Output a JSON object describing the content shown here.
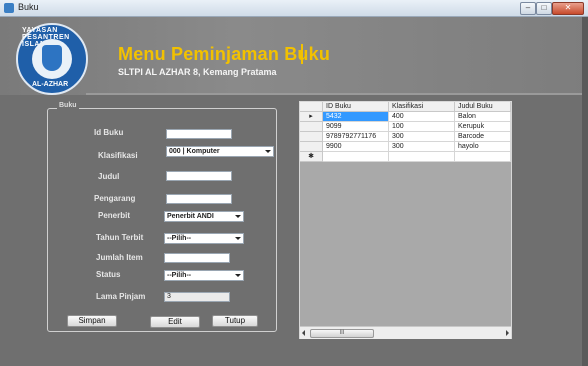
{
  "window": {
    "title": "Buku",
    "min_label": "–",
    "max_label": "□",
    "close_label": "✕"
  },
  "header": {
    "title": "Menu  Peminjaman Buku",
    "subtitle": "SLTPI AL AZHAR 8,  Kemang Pratama",
    "logo_ring_top": "YAYASAN PESANTREN ISLAM",
    "logo_ring_bottom": "AL-AZHAR"
  },
  "form": {
    "group_label": "Buku",
    "id_buku_label": "Id Buku",
    "id_buku_value": "",
    "klasifikasi_label": "Klasifikasi",
    "klasifikasi_value": "000   | Komputer",
    "judul_label": "Judul",
    "judul_value": "",
    "pengarang_label": "Pengarang",
    "pengarang_value": "",
    "penerbit_label": "Penerbit",
    "penerbit_value": "Penerbit ANDI",
    "tahun_label": "Tahun Terbit",
    "tahun_value": "--Pilih--",
    "jumlah_label": "Jumlah Item",
    "jumlah_value": "",
    "status_label": "Status",
    "status_value": "--Pilih--",
    "lama_label": "Lama Pinjam",
    "lama_value": "3"
  },
  "buttons": {
    "simpan": "Simpan",
    "edit": "Edit",
    "tutup": "Tutup"
  },
  "grid": {
    "columns": [
      "ID Buku",
      "Klasifikasi",
      "Judul Buku"
    ],
    "rows": [
      {
        "marker": "▸",
        "cells": [
          "5432",
          "400",
          "Balon"
        ]
      },
      {
        "marker": "",
        "cells": [
          "9099",
          "100",
          "Kerupuk"
        ]
      },
      {
        "marker": "",
        "cells": [
          "9789792771176",
          "300",
          "Barcode"
        ]
      },
      {
        "marker": "",
        "cells": [
          "9900",
          "300",
          "hayolo"
        ]
      },
      {
        "marker": "✱",
        "cells": [
          "",
          "",
          ""
        ]
      }
    ],
    "scroll_thumb": "III"
  }
}
